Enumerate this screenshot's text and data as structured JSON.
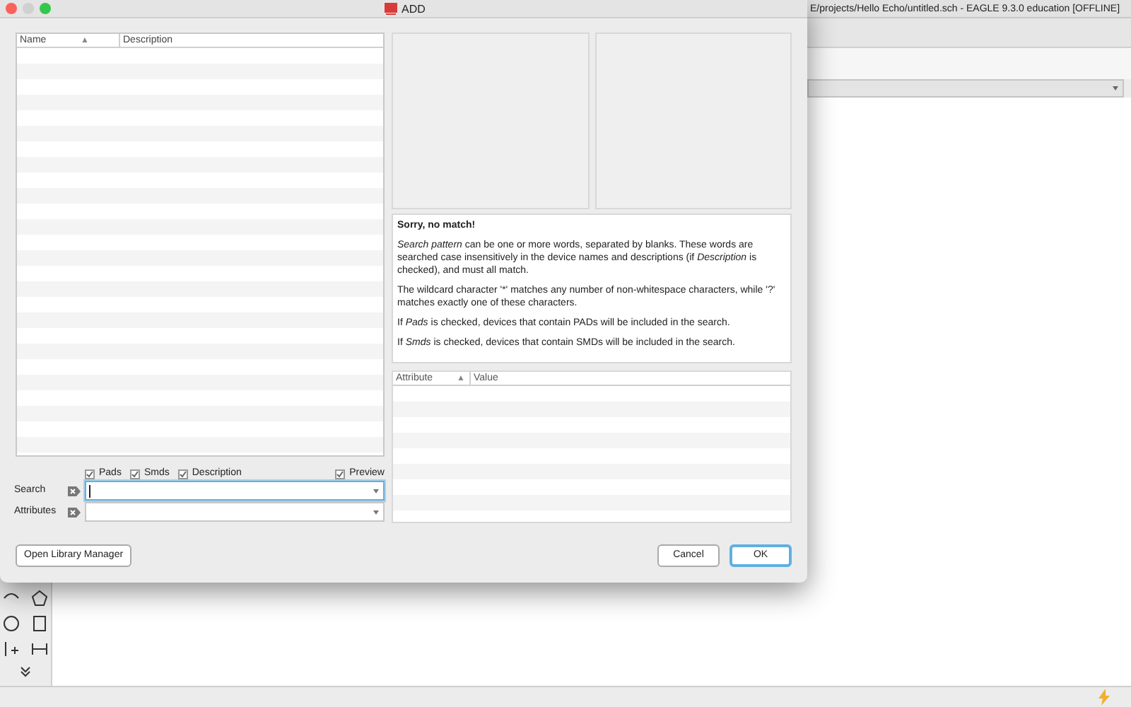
{
  "app": {
    "title": "E/projects/Hello Echo/untitled.sch - EAGLE 9.3.0 education [OFFLINE]"
  },
  "dialog": {
    "title": "ADD",
    "device_list": {
      "columns": [
        "Name",
        "▲",
        "Description"
      ]
    },
    "options": [
      {
        "label": "Pads",
        "checked": true
      },
      {
        "label": "Smds",
        "checked": true
      },
      {
        "label": "Description",
        "checked": true
      }
    ],
    "preview": {
      "label": "Preview",
      "checked": true
    },
    "search": {
      "label": "Search"
    },
    "attributes": {
      "label": "Attributes"
    },
    "info": {
      "heading": "Sorry, no match!",
      "paragraphs": [
        "*Search pattern* can be one or more words, separated by blanks. These words are searched case insensitively in the device names and descriptions (if *Description* is checked), and must all match.",
        "The wildcard character '*' matches any number of non-whitespace characters, while '?' matches exactly one of these characters.",
        "If *Pads* is checked, devices that contain PADs will be included in the search.",
        "If *Smds* is checked, devices that contain SMDs will be included in the search."
      ]
    },
    "attribute_table": {
      "columns": [
        "Attribute",
        "▲",
        "Value"
      ]
    },
    "buttons": [
      {
        "label": "Open Library Manager",
        "kind": "plain"
      },
      {
        "label": "Cancel",
        "kind": "plain"
      },
      {
        "label": "OK",
        "kind": "default"
      }
    ]
  }
}
